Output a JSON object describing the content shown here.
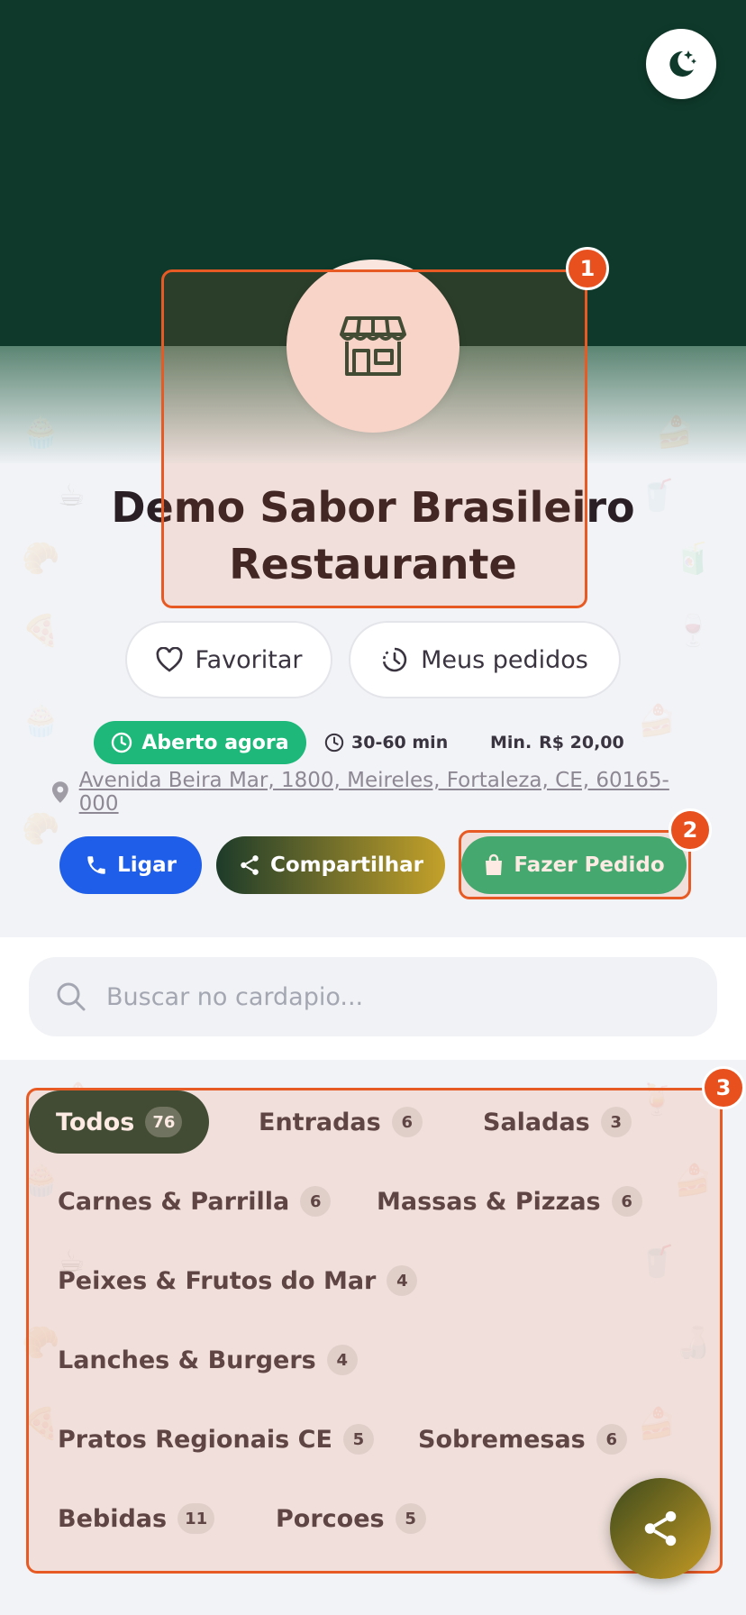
{
  "header": {
    "theme_toggle_icon": "moon-stars-icon",
    "logo_icon": "storefront-icon"
  },
  "restaurant": {
    "name": "Demo Sabor Brasileiro Restaurante",
    "favorite_label": "Favoritar",
    "orders_label": "Meus pedidos",
    "status": "Aberto agora",
    "delivery_time": "30-60 min",
    "min_label": "Min.",
    "min_value": "R$ 20,00",
    "address": "Avenida Beira Mar, 1800, Meireles, Fortaleza, CE, 60165-000"
  },
  "actions": {
    "call": "Ligar",
    "share": "Compartilhar",
    "order": "Fazer Pedido"
  },
  "search": {
    "placeholder": "Buscar no cardapio..."
  },
  "categories": [
    {
      "label": "Todos",
      "count": "76",
      "active": true
    },
    {
      "label": "Entradas",
      "count": "6"
    },
    {
      "label": "Saladas",
      "count": "3"
    },
    {
      "label": "Carnes & Parrilla",
      "count": "6"
    },
    {
      "label": "Massas & Pizzas",
      "count": "6"
    },
    {
      "label": "Peixes & Frutos do Mar",
      "count": "4"
    },
    {
      "label": "Lanches & Burgers",
      "count": "4"
    },
    {
      "label": "Pratos Regionais CE",
      "count": "5"
    },
    {
      "label": "Sobremesas",
      "count": "6"
    },
    {
      "label": "Bebidas",
      "count": "11"
    },
    {
      "label": "Porcoes",
      "count": "5"
    }
  ],
  "annotations": [
    "1",
    "2",
    "3"
  ],
  "colors": {
    "hero": "#0f3a2b",
    "open": "#1db87a",
    "call": "#1f5ee8",
    "order": "#2db57a",
    "accent": "#e8501e"
  }
}
